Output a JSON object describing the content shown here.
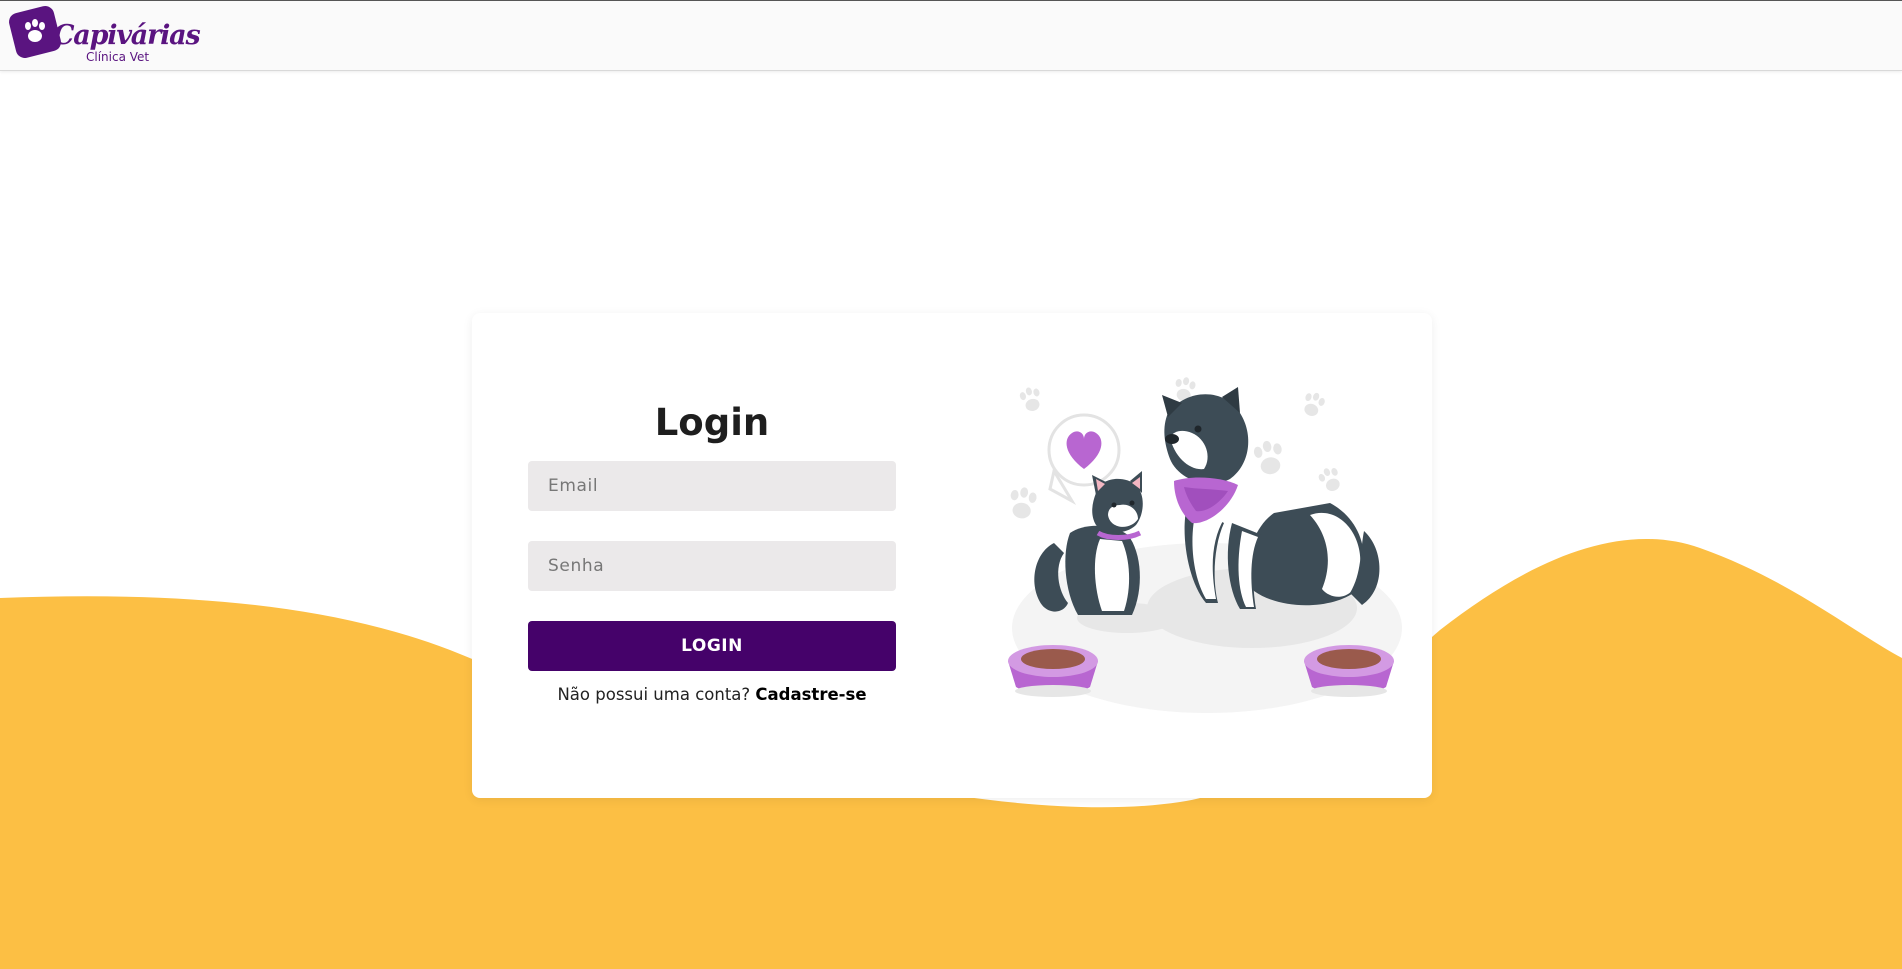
{
  "brand": {
    "name": "Capivárias",
    "subtitle": "Clínica Vet"
  },
  "colors": {
    "brand_purple": "#45026a",
    "wave_yellow": "#fcbf44",
    "input_bg": "#ebe9ea",
    "illustration_accent": "#b866d1"
  },
  "login": {
    "title": "Login",
    "email_placeholder": "Email",
    "password_placeholder": "Senha",
    "submit_label": "LOGIN",
    "signup_prompt": "Não possui uma conta?",
    "signup_link": "Cadastre-se"
  },
  "illustration": {
    "subject": "cat and dog with food bowls and heart speech bubble",
    "icons": [
      "paw-icon",
      "heart-icon",
      "food-bowl-icon"
    ]
  }
}
